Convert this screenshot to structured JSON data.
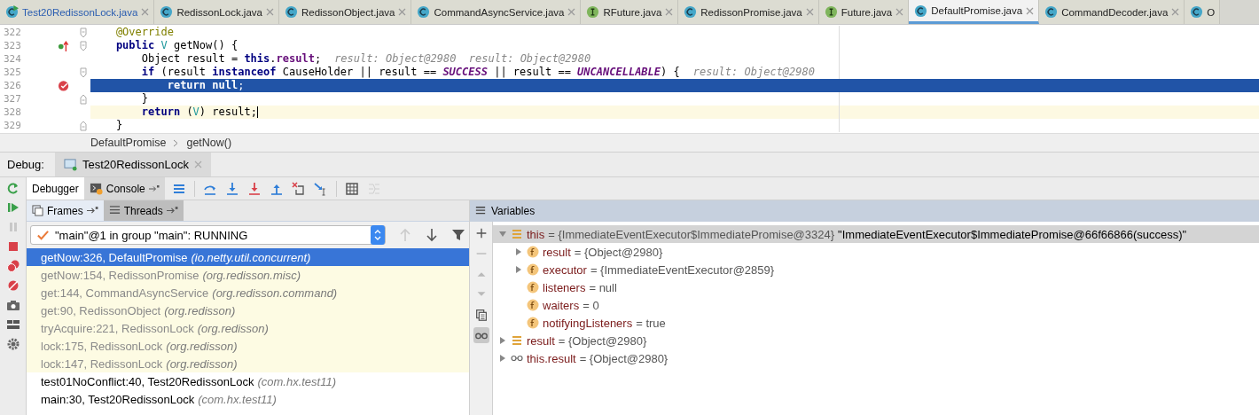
{
  "editor_tabs": [
    {
      "kind": "class-run",
      "label": "Test20RedissonLock.java",
      "selected": false
    },
    {
      "kind": "class",
      "label": "RedissonLock.java",
      "selected": false
    },
    {
      "kind": "class",
      "label": "RedissonObject.java",
      "selected": false
    },
    {
      "kind": "class",
      "label": "CommandAsyncService.java",
      "selected": false
    },
    {
      "kind": "interface",
      "label": "RFuture.java",
      "selected": false
    },
    {
      "kind": "class",
      "label": "RedissonPromise.java",
      "selected": false
    },
    {
      "kind": "interface",
      "label": "Future.java",
      "selected": false
    },
    {
      "kind": "class",
      "label": "DefaultPromise.java",
      "selected": true
    },
    {
      "kind": "class",
      "label": "CommandDecoder.java",
      "selected": false
    },
    {
      "kind": "class",
      "label": "O",
      "selected": false
    }
  ],
  "code": {
    "lines": [
      {
        "number": "322",
        "override": false,
        "breakpoint": false,
        "fold_start": true,
        "fold_end": false,
        "execution_point": false,
        "caret_line": false,
        "segments": [
          {
            "kind": "annotation",
            "text": "    @Override"
          }
        ]
      },
      {
        "number": "323",
        "override": true,
        "breakpoint": false,
        "fold_start": true,
        "fold_end": false,
        "execution_point": false,
        "caret_line": false,
        "segments": [
          {
            "kind": "keyword",
            "text": "    public "
          },
          {
            "kind": "type",
            "text": "V"
          },
          {
            "kind": "plain",
            "text": " getNow() {"
          }
        ]
      },
      {
        "number": "324",
        "override": false,
        "breakpoint": false,
        "fold_start": false,
        "fold_end": false,
        "execution_point": false,
        "caret_line": false,
        "segments": [
          {
            "kind": "plain",
            "text": "        Object result = "
          },
          {
            "kind": "keyword",
            "text": "this"
          },
          {
            "kind": "plain",
            "text": "."
          },
          {
            "kind": "field",
            "text": "result"
          },
          {
            "kind": "plain",
            "text": ";"
          },
          {
            "kind": "hint",
            "text": "result: Object@2980  result: Object@2980"
          }
        ]
      },
      {
        "number": "325",
        "override": false,
        "breakpoint": false,
        "fold_start": true,
        "fold_end": false,
        "execution_point": false,
        "caret_line": false,
        "segments": [
          {
            "kind": "keyword",
            "text": "        if"
          },
          {
            "kind": "plain",
            "text": " (result "
          },
          {
            "kind": "keyword",
            "text": "instanceof"
          },
          {
            "kind": "plain",
            "text": " CauseHolder || result == "
          },
          {
            "kind": "constant",
            "text": "SUCCESS"
          },
          {
            "kind": "plain",
            "text": " || result == "
          },
          {
            "kind": "constant",
            "text": "UNCANCELLABLE"
          },
          {
            "kind": "plain",
            "text": ") {"
          },
          {
            "kind": "hint",
            "text": "result: Object@2980"
          }
        ]
      },
      {
        "number": "326",
        "override": false,
        "breakpoint": true,
        "fold_start": false,
        "fold_end": false,
        "execution_point": true,
        "caret_line": false,
        "segments": [
          {
            "kind": "keyword",
            "text": "            return null"
          },
          {
            "kind": "plain",
            "text": ";"
          }
        ]
      },
      {
        "number": "327",
        "override": false,
        "breakpoint": false,
        "fold_start": false,
        "fold_end": true,
        "execution_point": false,
        "caret_line": false,
        "segments": [
          {
            "kind": "plain",
            "text": "        }"
          }
        ]
      },
      {
        "number": "328",
        "override": false,
        "breakpoint": false,
        "fold_start": false,
        "fold_end": false,
        "execution_point": false,
        "caret_line": true,
        "segments": [
          {
            "kind": "keyword",
            "text": "        return"
          },
          {
            "kind": "plain",
            "text": " ("
          },
          {
            "kind": "type",
            "text": "V"
          },
          {
            "kind": "plain",
            "text": ") result;"
          }
        ]
      },
      {
        "number": "329",
        "override": false,
        "breakpoint": false,
        "fold_start": false,
        "fold_end": true,
        "execution_point": false,
        "caret_line": false,
        "segments": [
          {
            "kind": "plain",
            "text": "    }"
          }
        ]
      }
    ],
    "breadcrumbs": [
      "DefaultPromise",
      "getNow()"
    ]
  },
  "debug": {
    "label": "Debug:",
    "session_tab": "Test20RedissonLock",
    "side_tools": [
      {
        "kind": "rerun",
        "disabled": false
      },
      {
        "kind": "resume",
        "disabled": false
      },
      {
        "kind": "pause",
        "disabled": true
      },
      {
        "kind": "stop",
        "disabled": false
      },
      {
        "kind": "breakpoints",
        "disabled": false
      },
      {
        "kind": "mute",
        "disabled": false
      },
      {
        "kind": "camera",
        "disabled": false
      },
      {
        "kind": "layout",
        "disabled": false
      },
      {
        "kind": "settings",
        "disabled": false
      }
    ],
    "tool_tabs": [
      {
        "kind": "plain",
        "label": "Debugger",
        "selected": true
      },
      {
        "kind": "console",
        "label": "Console",
        "selected": false
      }
    ],
    "toolbar": [
      {
        "kind": "frames-list",
        "disabled": false
      },
      {
        "kind": "step-over",
        "disabled": false
      },
      {
        "kind": "step-into",
        "disabled": false
      },
      {
        "kind": "force-step-into",
        "disabled": false
      },
      {
        "kind": "step-out",
        "disabled": false
      },
      {
        "kind": "drop-frame",
        "disabled": false
      },
      {
        "kind": "run-to-cursor",
        "disabled": false
      },
      {
        "kind": "evaluate",
        "disabled": false
      },
      {
        "kind": "trace",
        "disabled": true
      }
    ]
  },
  "frames_panel": {
    "tabs": [
      {
        "kind": "frames",
        "label": "Frames",
        "selected": true
      },
      {
        "kind": "threads",
        "label": "Threads",
        "selected": false
      }
    ],
    "thread": "\"main\"@1 in group \"main\": RUNNING",
    "nav": [
      {
        "kind": "up",
        "disabled": true
      },
      {
        "kind": "down",
        "disabled": false
      },
      {
        "kind": "filter",
        "disabled": false
      }
    ],
    "frames": [
      {
        "method": "getNow:326, DefaultPromise",
        "package": "(io.netty.util.concurrent)",
        "selected": true,
        "library": false
      },
      {
        "method": "getNow:154, RedissonPromise",
        "package": "(org.redisson.misc)",
        "selected": false,
        "library": true
      },
      {
        "method": "get:144, CommandAsyncService",
        "package": "(org.redisson.command)",
        "selected": false,
        "library": true
      },
      {
        "method": "get:90, RedissonObject",
        "package": "(org.redisson)",
        "selected": false,
        "library": true
      },
      {
        "method": "tryAcquire:221, RedissonLock",
        "package": "(org.redisson)",
        "selected": false,
        "library": true
      },
      {
        "method": "lock:175, RedissonLock",
        "package": "(org.redisson)",
        "selected": false,
        "library": true
      },
      {
        "method": "lock:147, RedissonLock",
        "package": "(org.redisson)",
        "selected": false,
        "library": true
      },
      {
        "method": "test01NoConflict:40, Test20RedissonLock",
        "package": "(com.hx.test11)",
        "selected": false,
        "library": false
      },
      {
        "method": "main:30, Test20RedissonLock",
        "package": "(com.hx.test11)",
        "selected": false,
        "library": false
      }
    ]
  },
  "variables_panel": {
    "title": "Variables",
    "tools": [
      {
        "kind": "add",
        "disabled": false,
        "selected": false
      },
      {
        "kind": "remove",
        "disabled": true,
        "selected": false
      },
      {
        "kind": "move-up",
        "disabled": true,
        "selected": false
      },
      {
        "kind": "move-down",
        "disabled": true,
        "selected": false
      },
      {
        "kind": "copy",
        "disabled": false,
        "selected": false
      },
      {
        "kind": "watches",
        "disabled": false,
        "selected": true
      }
    ],
    "variables": [
      {
        "kind": "object",
        "name": "this",
        "value": "= {ImmediateEventExecutor$ImmediatePromise@3324}",
        "text": "\"ImmediateEventExecutor$ImmediatePromise@66f66866(success)\"",
        "expanded": true,
        "selected": true,
        "children": [
          {
            "kind": "field",
            "name": "result",
            "value": "= {Object@2980}",
            "expanded": false,
            "selected": false
          },
          {
            "kind": "field",
            "name": "executor",
            "value": "= {ImmediateEventExecutor@2859}",
            "expanded": false,
            "selected": false
          },
          {
            "kind": "field",
            "name": "listeners",
            "value": "= null",
            "selected": false
          },
          {
            "kind": "field",
            "name": "waiters",
            "value": "= 0",
            "selected": false
          },
          {
            "kind": "field",
            "name": "notifyingListeners",
            "value": "= true",
            "selected": false
          }
        ]
      },
      {
        "kind": "object",
        "name": "result",
        "value": "= {Object@2980}",
        "expanded": false,
        "selected": false
      },
      {
        "kind": "watch",
        "name": "this.result",
        "value": "= {Object@2980}",
        "expanded": false,
        "selected": false
      }
    ]
  }
}
